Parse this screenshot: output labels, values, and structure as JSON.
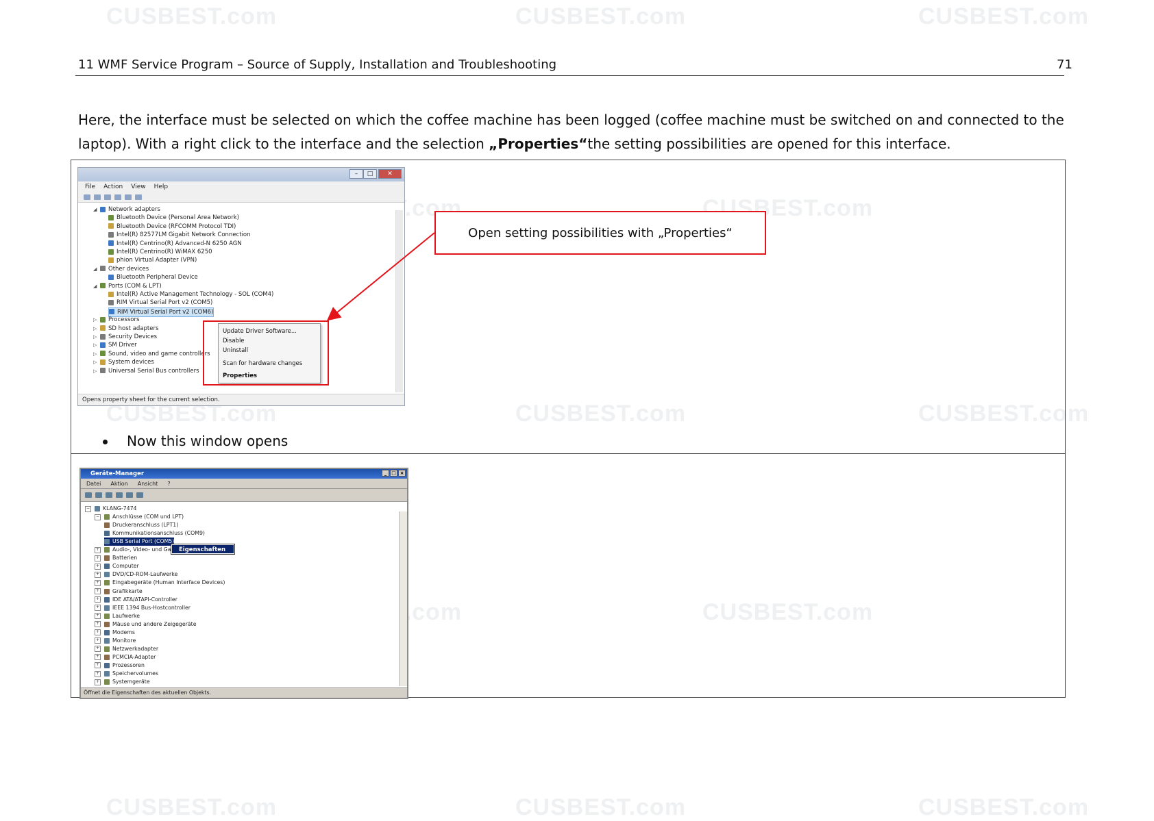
{
  "header": {
    "title": "11 WMF Service Program – Source of Supply, Installation and Troubleshooting",
    "page_number": "71"
  },
  "intro": {
    "text_before": "Here, the interface must be selected on which the coffee machine has been logged (coffee machine must be switched on and connected to the laptop). With a right click to the interface and the selection ",
    "bold": "„Properties“",
    "text_after": "the setting possibilities are opened for this interface."
  },
  "callout": {
    "text": "Open setting possibilities with „Properties“"
  },
  "bullet": {
    "text": "Now this window opens"
  },
  "watermark": {
    "text": "CUSBEST.com"
  },
  "screenshot_win7": {
    "menu": [
      "File",
      "Action",
      "View",
      "Help"
    ],
    "tree": [
      {
        "label": "Network adapters",
        "level": 0,
        "expanded": true
      },
      {
        "label": "Bluetooth Device (Personal Area Network)",
        "level": 1
      },
      {
        "label": "Bluetooth Device (RFCOMM Protocol TDI)",
        "level": 1
      },
      {
        "label": "Intel(R) 82577LM Gigabit Network Connection",
        "level": 1
      },
      {
        "label": "Intel(R) Centrino(R) Advanced-N 6250 AGN",
        "level": 1
      },
      {
        "label": "Intel(R) Centrino(R) WiMAX 6250",
        "level": 1
      },
      {
        "label": "phion Virtual Adapter (VPN)",
        "level": 1
      },
      {
        "label": "Other devices",
        "level": 0,
        "expanded": true
      },
      {
        "label": "Bluetooth Peripheral Device",
        "level": 1
      },
      {
        "label": "Ports (COM & LPT)",
        "level": 0,
        "expanded": true
      },
      {
        "label": "Intel(R) Active Management Technology - SOL (COM4)",
        "level": 1
      },
      {
        "label": "RIM Virtual Serial Port v2 (COM5)",
        "level": 1
      },
      {
        "label": "RIM Virtual Serial Port v2 (COM6)",
        "level": 1,
        "selected": true
      },
      {
        "label": "Processors",
        "level": 0
      },
      {
        "label": "SD host adapters",
        "level": 0
      },
      {
        "label": "Security Devices",
        "level": 0
      },
      {
        "label": "SM Driver",
        "level": 0
      },
      {
        "label": "Sound, video and game controllers",
        "level": 0
      },
      {
        "label": "System devices",
        "level": 0
      },
      {
        "label": "Universal Serial Bus controllers",
        "level": 0
      }
    ],
    "context_menu": [
      "Update Driver Software...",
      "Disable",
      "Uninstall",
      "Scan for hardware changes",
      "Properties"
    ],
    "status": "Opens property sheet for the current selection."
  },
  "screenshot_xp": {
    "title": "Geräte-Manager",
    "menu": [
      "Datei",
      "Aktion",
      "Ansicht",
      "?"
    ],
    "tree": [
      {
        "label": "KLANG-7474",
        "level": 0
      },
      {
        "label": "Anschlüsse (COM und LPT)",
        "level": 1
      },
      {
        "label": "Druckeranschluss (LPT1)",
        "level": 2
      },
      {
        "label": "Kommunikationsanschluss (COM9)",
        "level": 2
      },
      {
        "label": "USB Serial Port (COM5)",
        "level": 2,
        "selected": true
      },
      {
        "label": "Audio-, Video- und Gamecontroller",
        "level": 1
      },
      {
        "label": "Batterien",
        "level": 1
      },
      {
        "label": "Computer",
        "level": 1
      },
      {
        "label": "DVD/CD-ROM-Laufwerke",
        "level": 1
      },
      {
        "label": "Eingabegeräte (Human Interface Devices)",
        "level": 1
      },
      {
        "label": "Grafikkarte",
        "level": 1
      },
      {
        "label": "IDE ATA/ATAPI-Controller",
        "level": 1
      },
      {
        "label": "IEEE 1394 Bus-Hostcontroller",
        "level": 1
      },
      {
        "label": "Laufwerke",
        "level": 1
      },
      {
        "label": "Mäuse und andere Zeigegeräte",
        "level": 1
      },
      {
        "label": "Modems",
        "level": 1
      },
      {
        "label": "Monitore",
        "level": 1
      },
      {
        "label": "Netzwerkadapter",
        "level": 1
      },
      {
        "label": "PCMCIA-Adapter",
        "level": 1
      },
      {
        "label": "Prozessoren",
        "level": 1
      },
      {
        "label": "Speichervolumes",
        "level": 1
      },
      {
        "label": "Systemgeräte",
        "level": 1
      }
    ],
    "context_item": "Eigenschaften",
    "status": "Öffnet die Eigenschaften des aktuellen Objekts."
  },
  "colors": {
    "highlight_red": "#e3141a",
    "xp_title_blue": "#1c4fa8"
  }
}
